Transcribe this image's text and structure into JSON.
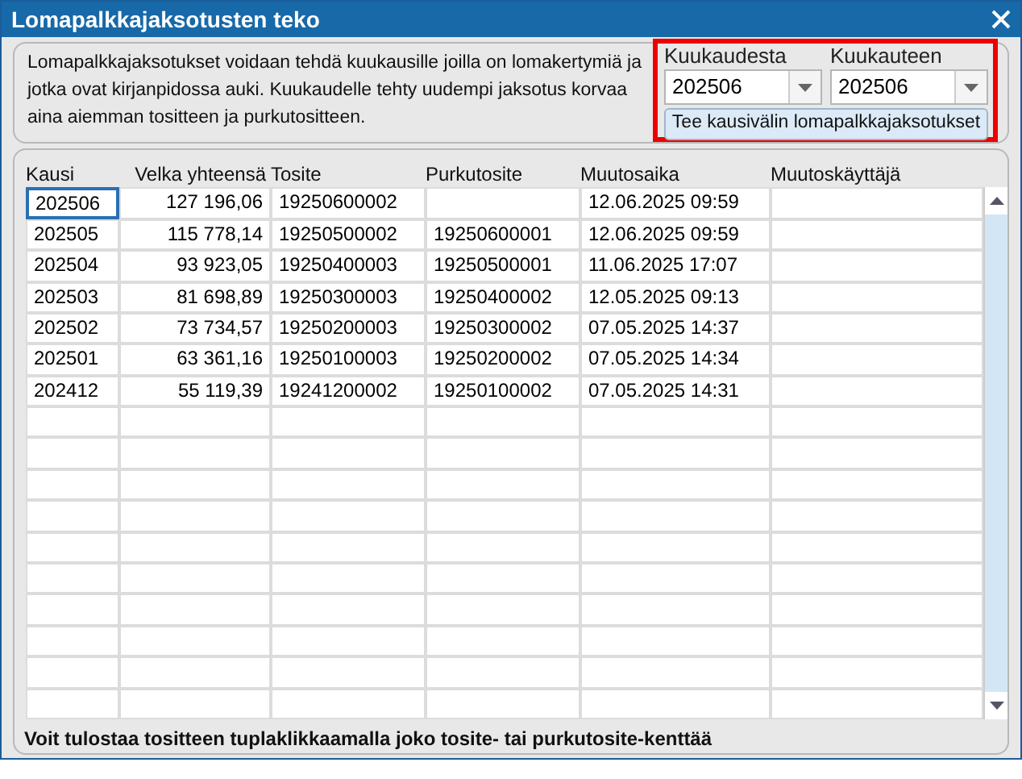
{
  "window": {
    "title": "Lomapalkkajaksotusten teko"
  },
  "info_text": "Lomapalkkajaksotukset voidaan tehdä kuukausille joilla on lomakertymiä ja jotka ovat kirjanpidossa auki. Kuukaudelle tehty uudempi jaksotus korvaa aina aiemman tositteen ja purkutositteen.",
  "period_from": {
    "label": "Kuukaudesta",
    "value": "202506"
  },
  "period_to": {
    "label": "Kuukauteen",
    "value": "202506"
  },
  "run_button": "Tee kausivälin lomapalkkajaksotukset",
  "table": {
    "columns": [
      "Kausi",
      "Velka yhteensä",
      "Tosite",
      "Purkutosite",
      "Muutosaika",
      "Muutoskäyttäjä"
    ],
    "rows": [
      {
        "cells": [
          "202506",
          "127 196,06",
          "19250600002",
          "",
          "12.06.2025 09:59",
          ""
        ],
        "selected": true
      },
      {
        "cells": [
          "202505",
          "115 778,14",
          "19250500002",
          "19250600001",
          "12.06.2025 09:59",
          ""
        ],
        "selected": false
      },
      {
        "cells": [
          "202504",
          "93 923,05",
          "19250400003",
          "19250500001",
          "11.06.2025 17:07",
          ""
        ],
        "selected": false
      },
      {
        "cells": [
          "202503",
          "81 698,89",
          "19250300003",
          "19250400002",
          "12.05.2025 09:13",
          ""
        ],
        "selected": false
      },
      {
        "cells": [
          "202502",
          "73 734,57",
          "19250200003",
          "19250300002",
          "07.05.2025 14:37",
          ""
        ],
        "selected": false
      },
      {
        "cells": [
          "202501",
          "63 361,16",
          "19250100003",
          "19250200002",
          "07.05.2025 14:34",
          ""
        ],
        "selected": false
      },
      {
        "cells": [
          "202412",
          "55 119,39",
          "19241200002",
          "19250100002",
          "07.05.2025 14:31",
          ""
        ],
        "selected": false
      }
    ]
  },
  "footer_text": "Voit tulostaa tositteen tuplaklikkaamalla joko tosite- tai purkutosite-kenttää"
}
